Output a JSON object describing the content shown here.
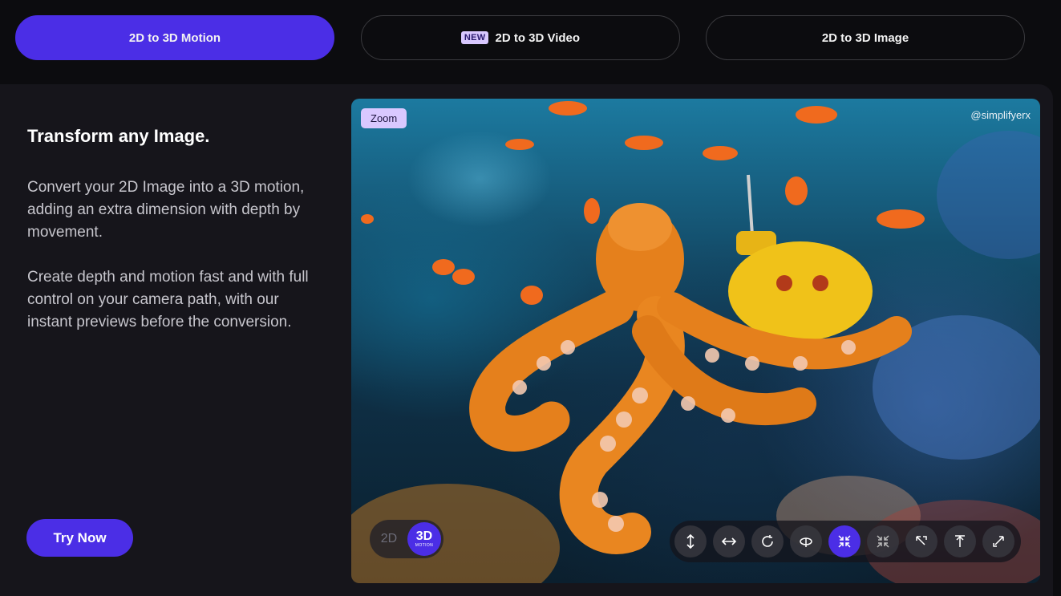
{
  "tabs": [
    {
      "label": "2D to 3D Motion",
      "active": true
    },
    {
      "label": "2D to 3D Video",
      "badge": "NEW",
      "active": false
    },
    {
      "label": "2D to 3D Image",
      "active": false
    }
  ],
  "content": {
    "heading": "Transform any Image.",
    "paragraph1": "Convert your 2D Image into a 3D motion, adding an extra dimension with depth by movement.",
    "paragraph2": "Create depth and motion fast and with full control on your camera path, with our instant previews before the conversion.",
    "cta": "Try Now"
  },
  "preview": {
    "zoom_label": "Zoom",
    "watermark": "@simplifyerx",
    "toggle": {
      "off_label": "2D",
      "on_label": "3D",
      "on_sublabel": "MOTION"
    },
    "controls": [
      {
        "name": "vertical-move-icon",
        "active": false
      },
      {
        "name": "horizontal-move-icon",
        "active": false
      },
      {
        "name": "rotate-icon",
        "active": false
      },
      {
        "name": "orbit-icon",
        "active": false
      },
      {
        "name": "zoom-in-icon",
        "active": true
      },
      {
        "name": "zoom-out-icon",
        "active": false
      },
      {
        "name": "dolly-left-icon",
        "active": false
      },
      {
        "name": "dolly-center-icon",
        "active": false
      },
      {
        "name": "dolly-right-icon",
        "active": false
      }
    ]
  },
  "colors": {
    "accent": "#4b2ee6",
    "badge": "#d9c8ff",
    "background": "#0c0c0f",
    "panel": "#16151b"
  }
}
